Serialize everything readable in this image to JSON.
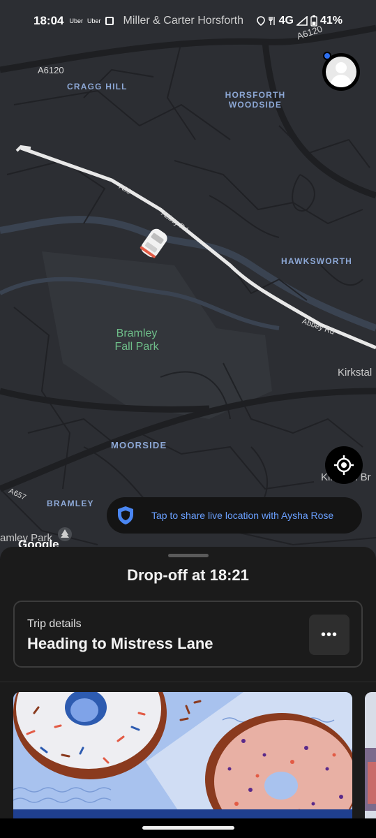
{
  "status_bar": {
    "time": "18:04",
    "app_icons": [
      "Uber",
      "Uber"
    ],
    "place": "Miller & Carter Horsforth",
    "network": "4G",
    "battery": "41%"
  },
  "map": {
    "areas": [
      "CRAGG HILL",
      "HORSFORTH\nWOODSIDE",
      "HAWKSWORTH",
      "MOORSIDE",
      "BRAMLEY"
    ],
    "roads": [
      "A6120",
      "A6120",
      "A657",
      "A65",
      "Abbey Rd",
      "Abbey Rd"
    ],
    "park": "Bramley\nFall Park",
    "places": [
      "Kirkstal",
      "Kirkstall Br",
      "amley Park"
    ],
    "attribution": "Google"
  },
  "share_location": {
    "text": "Tap to share live location with Aysha Rose",
    "accent": "#6aa0ff"
  },
  "sheet": {
    "title": "Drop-off at 18:21",
    "trip_label": "Trip details",
    "destination": "Heading to Mistress Lane",
    "more_label": "•••"
  },
  "icons": {
    "profile": "profile-avatar-icon",
    "locate": "crosshair-icon",
    "shield": "shield-icon",
    "car": "car-icon"
  }
}
